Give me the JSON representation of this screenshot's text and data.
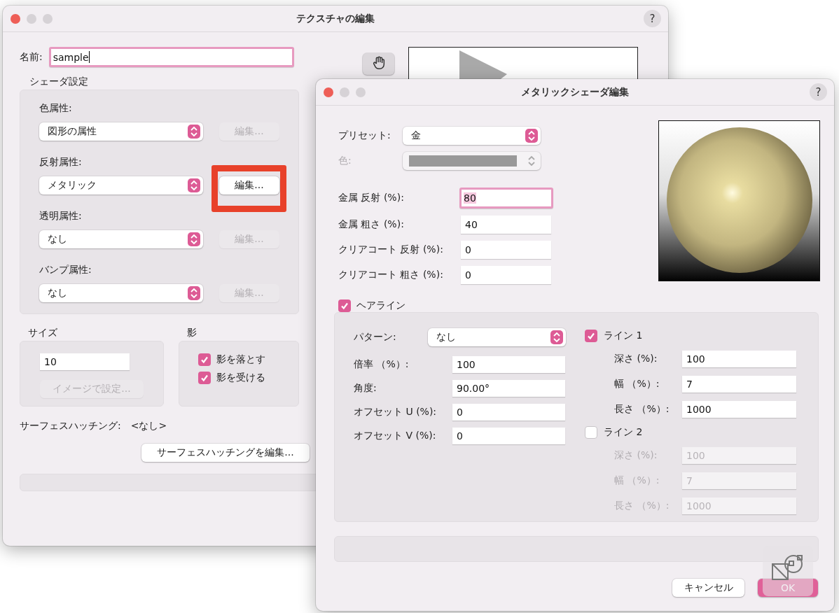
{
  "back_window": {
    "title": "テクスチャの編集",
    "help": "?",
    "name_label": "名前:",
    "name_value": "sample",
    "name_focused": true,
    "shader_title": "シェーダ設定",
    "shader_rows": [
      {
        "label": "色属性:",
        "value": "図形の属性",
        "edit": "編集...",
        "disabled": true,
        "highlighted": false
      },
      {
        "label": "反射属性:",
        "value": "メタリック",
        "edit": "編集...",
        "disabled": false,
        "highlighted": true
      },
      {
        "label": "透明属性:",
        "value": "なし",
        "edit": "編集...",
        "disabled": true,
        "highlighted": false
      },
      {
        "label": "バンプ属性:",
        "value": "なし",
        "edit": "編集...",
        "disabled": true,
        "highlighted": false
      }
    ],
    "size": {
      "title": "サイズ",
      "value": "10",
      "button": "イメージで設定...",
      "disabled": true
    },
    "shadow": {
      "title": "影",
      "options": [
        {
          "label": "影を落とす",
          "checked": true
        },
        {
          "label": "影を受ける",
          "checked": true
        }
      ]
    },
    "hatching_label": "サーフェスハッチング:",
    "hatching_value": "<なし>",
    "hatching_button": "サーフェスハッチングを編集..."
  },
  "front_window": {
    "title": "メタリックシェーダ編集",
    "help": "?",
    "preset": {
      "label": "プリセット:",
      "value": "金"
    },
    "color": {
      "label": "色:",
      "disabled": true
    },
    "fields": [
      {
        "label": "金属 反射 (%):",
        "value": "80",
        "focused": true
      },
      {
        "label": "金属 粗さ (%):",
        "value": "40",
        "focused": false
      },
      {
        "label": "クリアコート 反射 (%):",
        "value": "0",
        "focused": false
      },
      {
        "label": "クリアコート 粗さ (%):",
        "value": "0",
        "focused": false
      }
    ],
    "hairline": {
      "label": "ヘアライン",
      "checked": true
    },
    "pattern": {
      "label": "パターン:",
      "value": "なし"
    },
    "hairline_fields": [
      {
        "label": "倍率 （%）:",
        "value": "100"
      },
      {
        "label": "角度:",
        "value": "90.00°"
      },
      {
        "label": "オフセット U (%):",
        "value": "0"
      },
      {
        "label": "オフセット V (%):",
        "value": "0"
      }
    ],
    "lines": [
      {
        "label": "ライン 1",
        "checked": true,
        "fields": [
          {
            "label": "深さ (%):",
            "value": "100"
          },
          {
            "label": "幅 （%）:",
            "value": "7"
          },
          {
            "label": "長さ （%）:",
            "value": "1000"
          }
        ]
      },
      {
        "label": "ライン 2",
        "checked": false,
        "fields": [
          {
            "label": "深さ (%):",
            "value": "100"
          },
          {
            "label": "幅 （%）:",
            "value": "7"
          },
          {
            "label": "長さ （%）:",
            "value": "1000"
          }
        ]
      }
    ],
    "cancel": "キャンセル",
    "ok": "OK"
  }
}
